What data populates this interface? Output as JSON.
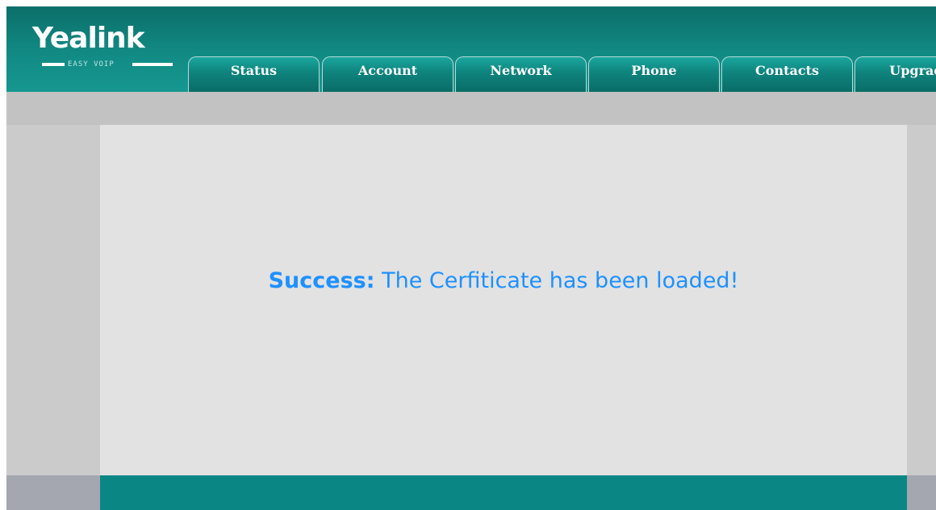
{
  "brand": {
    "name": "Yealink",
    "tagline": "EASY VOIP"
  },
  "nav": {
    "tabs": [
      {
        "label": "Status"
      },
      {
        "label": "Account"
      },
      {
        "label": "Network"
      },
      {
        "label": "Phone"
      },
      {
        "label": "Contacts"
      },
      {
        "label": "Upgrade"
      }
    ]
  },
  "message": {
    "prefix": "Success:",
    "text": "The Cerfiticate has been loaded!"
  },
  "colors": {
    "header": "#128a84",
    "message": "#1e90ff",
    "content_bg": "#e2e2e2",
    "footer": "#0a8784"
  }
}
